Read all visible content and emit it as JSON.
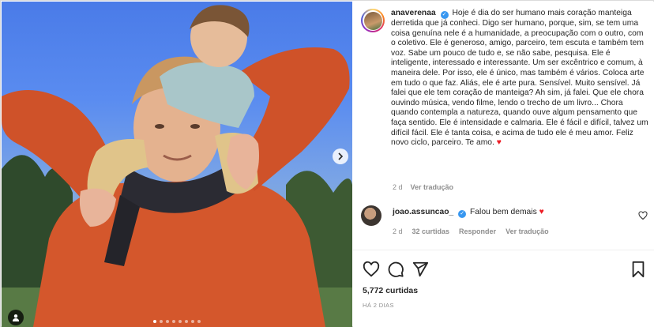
{
  "post": {
    "username": "anaverenaa",
    "caption": "Hoje é dia do ser humano mais coração manteiga derretida que já conheci. Digo ser humano, porque, sim, se tem uma coisa genuína nele é a humanidade, a preocupação com o outro, com o coletivo. Ele é generoso, amigo, parceiro, tem escuta e também tem voz. Sabe um pouco de tudo e, se não sabe, pesquisa. Ele é inteligente, interessado e interessante. Um ser excêntrico e comum, à maneira dele. Por isso, ele é único, mas também é vários. Coloca arte em tudo o que faz. Aliás, ele é arte pura. Sensível. Muito sensível. Já falei que ele tem coração de manteiga? Ah sim, já falei. Que ele chora ouvindo música, vendo filme, lendo o trecho de um livro... Chora quando contempla a natureza, quando ouve algum pensamento que faça sentido. Ele é intensidade e calmaria. Ele é fácil e difícil, talvez um difícil fácil. Ele é tanta coisa, e acima de tudo ele é meu amor. Feliz novo ciclo, parceiro. Te amo.",
    "caption_emoji": "♥",
    "age": "2 d",
    "see_translation": "Ver tradução",
    "verified_mark": "✓"
  },
  "comment": {
    "username": "joao.assuncao_",
    "text": "Falou bem demais",
    "emoji": "♥",
    "age": "2 d",
    "likes": "32 curtidas",
    "reply": "Responder",
    "see_translation": "Ver tradução"
  },
  "stats": {
    "likes": "5,772 curtidas",
    "date": "HÁ 2 DIAS"
  },
  "carousel": {
    "total": 8,
    "active": 1
  },
  "colors": {
    "accent": "#3897f0",
    "heart": "#ed1c24",
    "shirt": "#d4572c"
  },
  "icons": [
    "heart-icon",
    "comment-icon",
    "share-icon",
    "bookmark-icon",
    "chevron-right-icon",
    "user-tag-icon",
    "verified-icon"
  ]
}
